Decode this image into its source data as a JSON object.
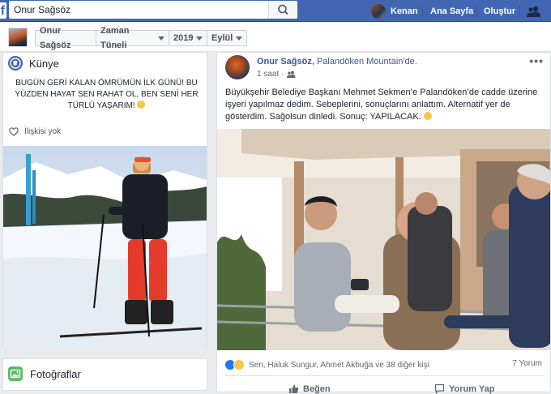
{
  "topbar": {
    "search_value": "Onur Sağsöz",
    "search_icon": "search-icon",
    "profile_name": "Kenan",
    "home_label": "Ana Sayfa",
    "create_label": "Oluştur",
    "friends_icon": "friend-requests-icon",
    "brand_color": "#4267b2"
  },
  "subheader": {
    "profile_label": "Onur Sağsöz",
    "timeline_label": "Zaman Tüneli",
    "year_label": "2019",
    "month_label": "Eylül"
  },
  "sidebar": {
    "kunye_title": "Künye",
    "bio": "BUGÜN GERİ KALAN ÖMRÜMÜN İLK GÜNÜ! BU YÜZDEN HAYAT SEN RAHAT OL, BEN SENİ HER TÜRLÜ YAŞARIM!",
    "relationship": "İlişkisi yok",
    "photos_title": "Fotoğraflar"
  },
  "post": {
    "author": "Onur Sağsöz",
    "separator": ",",
    "location": "Palandöken Mountain",
    "location_suffix": "'de.",
    "time": "1 saat",
    "privacy_icon": "friends-icon",
    "text": "Büyükşehir Belediye Başkanı Mehmet Sekmen’e Palandöken’de cadde üzerine işyeri yapılmaz dedim. Sebeplerini, sonuçlarını anlattım. Alternatif yer de gösterdim. Sağolsun dinledi. Sonuç: YAPILACAK.",
    "reactions_text": "Sen, Haluk Sungur, Ahmet Akbuğa ve 38 diğer kişi",
    "comments_text": "7 Yorum",
    "like_label": "Beğen",
    "comment_label": "Yorum Yap"
  }
}
